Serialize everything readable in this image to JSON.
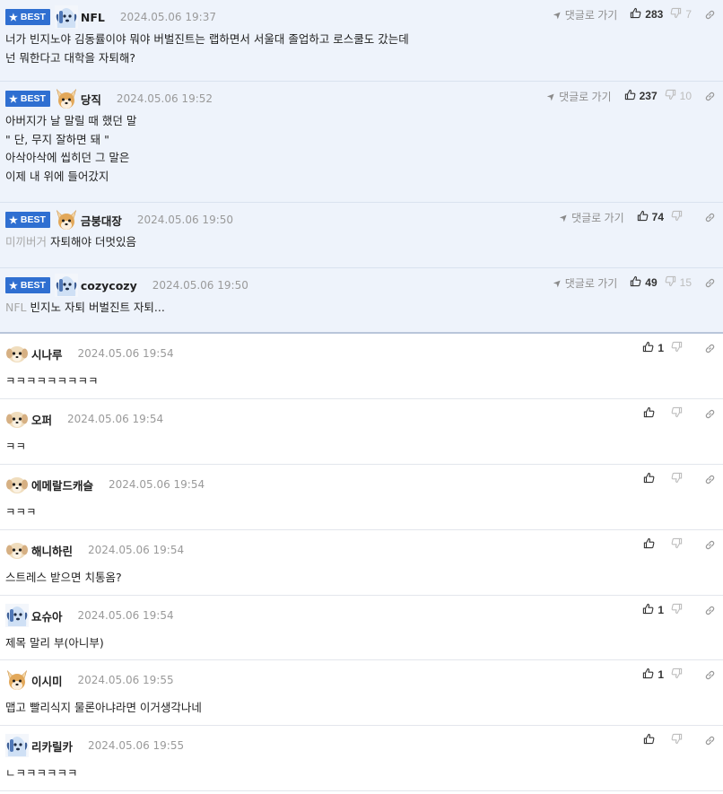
{
  "best_label": "BEST",
  "reply_link_label": "댓글로 가기",
  "comments": [
    {
      "nick": "NFL",
      "time": "2024.05.06 19:37",
      "avatar": "blue-puppy",
      "prefix": "",
      "lines": [
        "너가 빈지노야 김동률이야 뭐야 버벌진트는 랩하면서 서울대 졸업하고 로스쿨도 갔는데",
        "넌 뭐한다고 대학을 자퇴해?"
      ],
      "likes": "283",
      "dislikes": "7",
      "best": true
    },
    {
      "nick": "당직",
      "time": "2024.05.06 19:52",
      "avatar": "fox-dog",
      "prefix": "",
      "lines": [
        "아버지가 날 말릴 때 했던 말",
        "\" 단, 무지 잘하면 돼 \"",
        "아삭아삭에 씹히던 그 말은",
        "이제 내 위에 들어갔지"
      ],
      "likes": "237",
      "dislikes": "10",
      "best": true
    },
    {
      "nick": "금붕대장",
      "time": "2024.05.06 19:50",
      "avatar": "fox-dog",
      "prefix": "미끼버거",
      "lines": [
        "자퇴해야 더멋있음"
      ],
      "likes": "74",
      "dislikes": "",
      "best": true
    },
    {
      "nick": "cozycozy",
      "time": "2024.05.06 19:50",
      "avatar": "blue-puppy",
      "prefix": "NFL",
      "lines": [
        "빈지노 자퇴 버벌진트 자퇴..."
      ],
      "likes": "49",
      "dislikes": "15",
      "best": true
    },
    {
      "nick": "시나루",
      "time": "2024.05.06 19:54",
      "avatar": "cream-puppy",
      "prefix": "",
      "lines": [
        "ㅋㅋㅋㅋㅋㅋㅋㅋㅋ"
      ],
      "likes": "1",
      "dislikes": "",
      "best": false
    },
    {
      "nick": "오퍼",
      "time": "2024.05.06 19:54",
      "avatar": "cream-puppy",
      "prefix": "",
      "lines": [
        "ㅋㅋ"
      ],
      "likes": "",
      "dislikes": "",
      "best": false
    },
    {
      "nick": "에메랄드캐슬",
      "time": "2024.05.06 19:54",
      "avatar": "cream-puppy",
      "prefix": "",
      "lines": [
        "ㅋㅋㅋ"
      ],
      "likes": "",
      "dislikes": "",
      "best": false
    },
    {
      "nick": "해니하린",
      "time": "2024.05.06 19:54",
      "avatar": "cream-puppy",
      "prefix": "",
      "lines": [
        "스트레스 받으면 치통옴?"
      ],
      "likes": "",
      "dislikes": "",
      "best": false
    },
    {
      "nick": "요슈아",
      "time": "2024.05.06 19:54",
      "avatar": "blue-puppy",
      "prefix": "",
      "lines": [
        "제목 말리 부(아니부)"
      ],
      "likes": "1",
      "dislikes": "",
      "best": false
    },
    {
      "nick": "이시미",
      "time": "2024.05.06 19:55",
      "avatar": "fox-dog",
      "prefix": "",
      "lines": [
        "맵고 빨리식지 물론아냐라면 이거생각나네"
      ],
      "likes": "1",
      "dislikes": "",
      "best": false
    },
    {
      "nick": "리카릴카",
      "time": "2024.05.06 19:55",
      "avatar": "blue-puppy",
      "prefix": "",
      "lines": [
        "ㄴㅋㅋㅋㅋㅋㅋ"
      ],
      "likes": "",
      "dislikes": "",
      "best": false
    }
  ],
  "colors": {
    "best_bg": "#eef3fb",
    "badge": "#2f6fd1",
    "time": "#9a9a9a"
  }
}
